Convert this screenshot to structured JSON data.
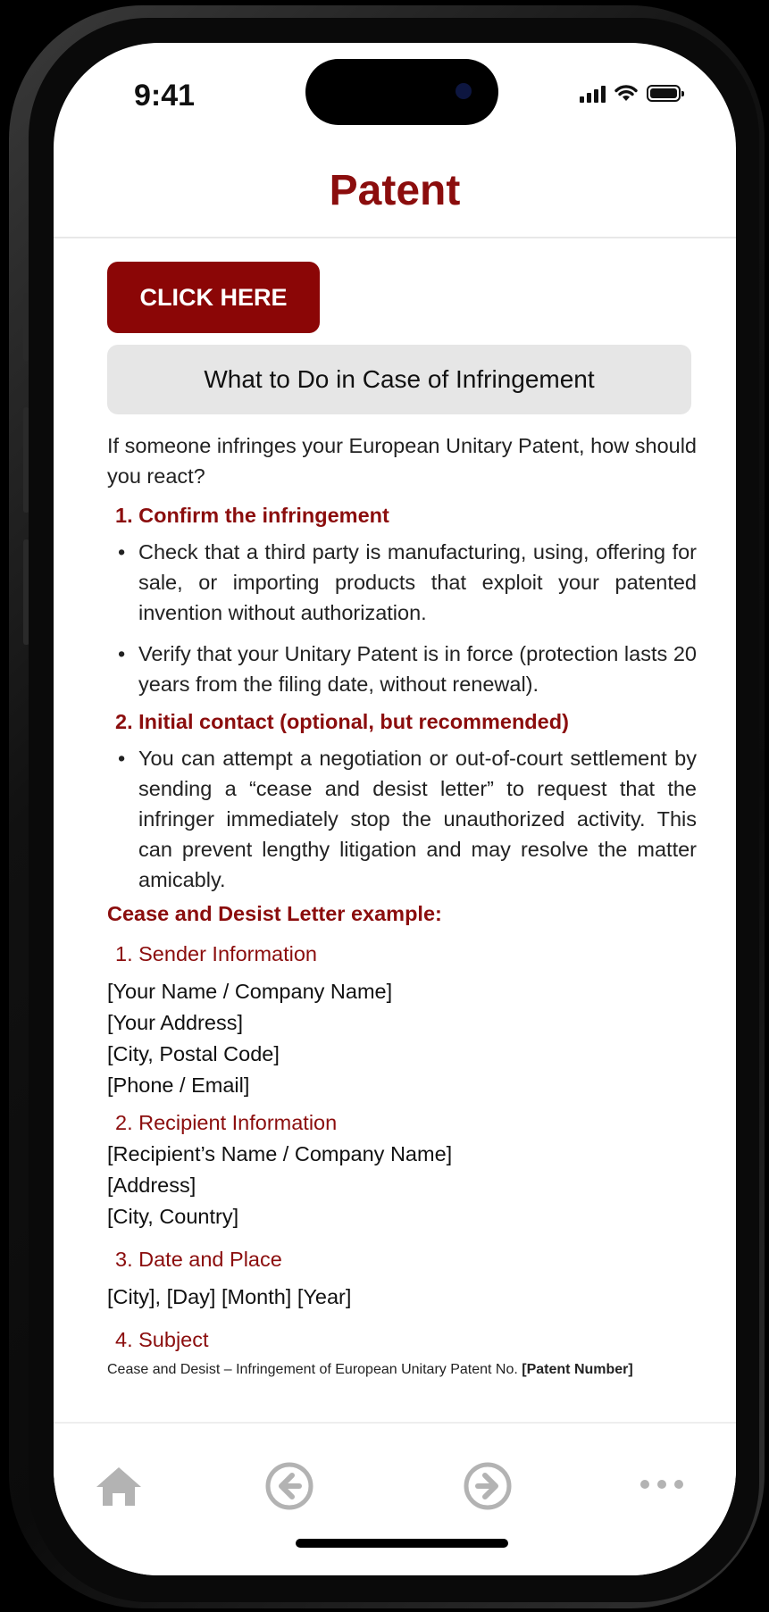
{
  "status_bar": {
    "time": "9:41"
  },
  "header": {
    "title": "Patent"
  },
  "cta": {
    "label": "CLICK HERE"
  },
  "section": {
    "title": "What to Do in Case of Infringement"
  },
  "intro": "If someone infringes your European Unitary Patent, how should you react?",
  "steps": [
    {
      "heading": "1. Confirm the infringement",
      "bullets": [
        "Check that a third party is manufacturing, using, offering for sale, or importing products that exploit your patented invention without authorization.",
        "Verify that your Unitary Patent is in force (protection lasts 20 years from the filing date, without renewal)."
      ]
    },
    {
      "heading": "2. Initial contact (optional, but recommended)",
      "bullets": [
        "You can attempt a negotiation or out-of-court settlement by sending a “cease and desist letter” to request that the infringer immediately stop the unauthorized activity. This can prevent lengthy litigation and may resolve the matter amicably."
      ]
    }
  ],
  "example": {
    "heading": "Cease and Desist Letter example:",
    "sender_heading": "1. Sender Information",
    "sender_lines": [
      "[Your Name / Company Name]",
      "[Your Address]",
      "[City, Postal Code]",
      "[Phone / Email]"
    ],
    "recipient_heading": "2. Recipient Information",
    "recipient_lines": [
      "[Recipient’s Name / Company Name]",
      "[Address]",
      "[City, Country]"
    ],
    "date_heading": "3. Date and Place",
    "date_line": "[City], [Day] [Month] [Year]",
    "subject_heading": "4. Subject",
    "subject_text": "Cease and Desist – Infringement of European Unitary Patent No. ",
    "subject_bold": "[Patent Number]"
  },
  "bottom_nav": {
    "icons": [
      "home-icon",
      "back-arrow-icon",
      "forward-arrow-icon",
      "more-icon"
    ],
    "icon_color": "#b3b3b3"
  },
  "colors": {
    "accent": "#8b0d0d",
    "button": "#8b0606",
    "section_bg": "#e6e6e6"
  }
}
